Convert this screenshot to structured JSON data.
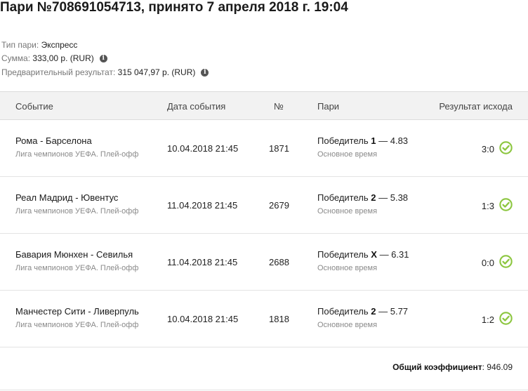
{
  "page_title": "Пари №708691054713, принято 7 апреля 2018 г. 19:04",
  "info": {
    "type_label": "Тип пари:",
    "type_value": "Экспресс",
    "sum_label": "Сумма:",
    "sum_value": "333,00 р. (RUR)",
    "prelim_label": "Предварительный результат:",
    "prelim_value": "315 047,97 р. (RUR)",
    "info_icon_glyph": "i"
  },
  "table": {
    "headers": {
      "event": "Событие",
      "date": "Дата события",
      "num": "№",
      "bet": "Пари",
      "result": "Результат исхода"
    },
    "rows": [
      {
        "event": "Рома - Барселона",
        "league": "Лига чемпионов УЕФА. Плей-офф",
        "date": "10.04.2018 21:45",
        "num": "1871",
        "bet_prefix": "Победитель",
        "bet_outcome": "1",
        "bet_odds": "— 4.83",
        "bet_period": "Основное время",
        "score": "3:0",
        "status_icon": "check-circle-icon"
      },
      {
        "event": "Реал Мадрид - Ювентус",
        "league": "Лига чемпионов УЕФА. Плей-офф",
        "date": "11.04.2018 21:45",
        "num": "2679",
        "bet_prefix": "Победитель",
        "bet_outcome": "2",
        "bet_odds": "— 5.38",
        "bet_period": "Основное время",
        "score": "1:3",
        "status_icon": "check-circle-icon"
      },
      {
        "event": "Бавария Мюнхен - Севилья",
        "league": "Лига чемпионов УЕФА. Плей-офф",
        "date": "11.04.2018 21:45",
        "num": "2688",
        "bet_prefix": "Победитель",
        "bet_outcome": "X",
        "bet_odds": "— 6.31",
        "bet_period": "Основное время",
        "score": "0:0",
        "status_icon": "check-circle-icon"
      },
      {
        "event": "Манчестер Сити - Ливерпуль",
        "league": "Лига чемпионов УЕФА. Плей-офф",
        "date": "10.04.2018 21:45",
        "num": "1818",
        "bet_prefix": "Победитель",
        "bet_outcome": "2",
        "bet_odds": "— 5.77",
        "bet_period": "Основное время",
        "score": "1:2",
        "status_icon": "check-circle-icon"
      }
    ]
  },
  "total": {
    "label": "Общий коэффициент",
    "value": ": 946.09"
  },
  "colors": {
    "win_check": "#8cc63f",
    "header_bg": "#f2f2f2"
  }
}
